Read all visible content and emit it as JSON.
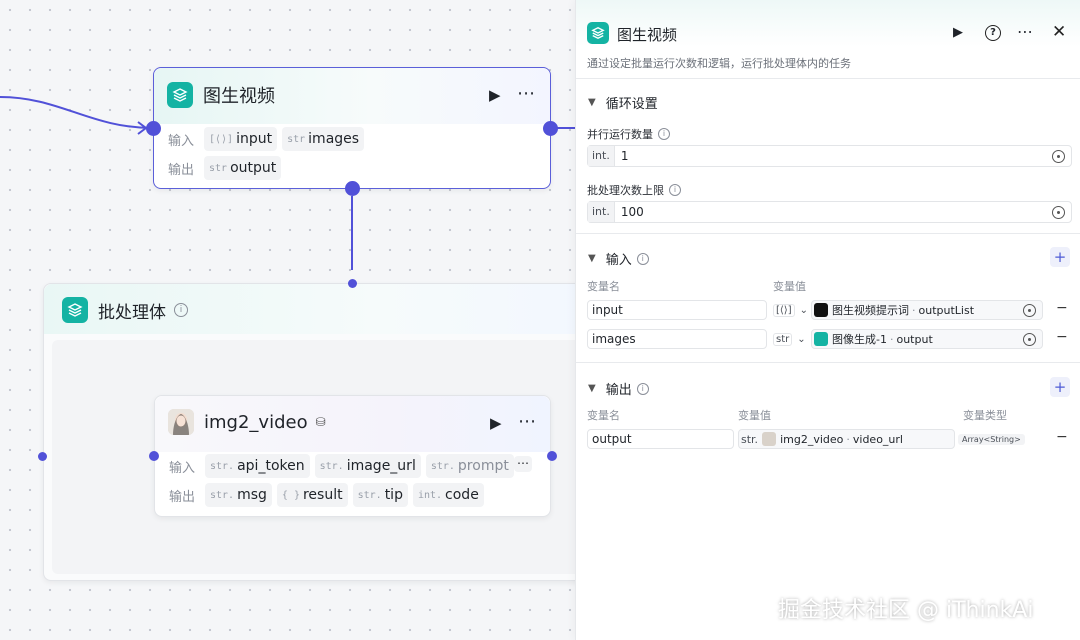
{
  "colors": {
    "accent": "#5151d8",
    "teal": "#14b3a3",
    "canvas": "#f5f6f8"
  },
  "top_node": {
    "title": "图生视频",
    "input_label": "输入",
    "output_label": "输出",
    "inputs": [
      {
        "type": "[⟨⟩]",
        "name": "input"
      },
      {
        "type": "str",
        "name": "images"
      }
    ],
    "outputs": [
      {
        "type": "str",
        "name": "output"
      }
    ]
  },
  "batch": {
    "title": "批处理体"
  },
  "inner_node": {
    "title": "img2_video",
    "input_label": "输入",
    "output_label": "输出",
    "inputs": [
      {
        "type": "str.",
        "name": "api_token"
      },
      {
        "type": "str.",
        "name": "image_url"
      },
      {
        "type": "str.",
        "name": "prompt"
      }
    ],
    "outputs": [
      {
        "type": "str.",
        "name": "msg"
      },
      {
        "type": "{ }",
        "name": "result"
      },
      {
        "type": "str.",
        "name": "tip"
      },
      {
        "type": "int.",
        "name": "code"
      }
    ]
  },
  "panel": {
    "title": "图生视频",
    "description": "通过设定批量运行次数和逻辑，运行批处理体内的任务",
    "loop_section": "循环设置",
    "parallel_label": "并行运行数量",
    "parallel_prefix": "int.",
    "parallel_value": "1",
    "max_label": "批处理次数上限",
    "max_prefix": "int.",
    "max_value": "100",
    "input_section": "输入",
    "input_col_name": "变量名",
    "input_col_value": "变量值",
    "input_rows": [
      {
        "name": "input",
        "type": "[⟨⟩]",
        "source": "图生视频提示词",
        "field": "outputList"
      },
      {
        "name": "images",
        "type": "str",
        "source": "图像生成-1",
        "field": "output"
      }
    ],
    "output_section": "输出",
    "output_col_name": "变量名",
    "output_col_value": "变量值",
    "output_col_type": "变量类型",
    "output_rows": [
      {
        "name": "output",
        "prefix": "str.",
        "source": "img2_video",
        "field": "video_url",
        "type": "Array<String>"
      }
    ]
  },
  "watermark": "掘金技术社区 @ iThinkAi"
}
